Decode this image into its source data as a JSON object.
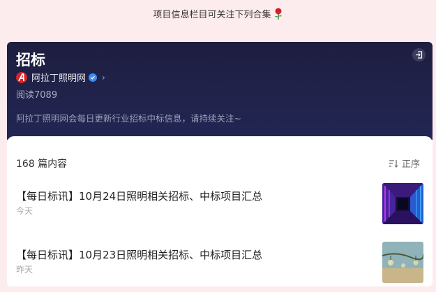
{
  "top_tip": {
    "text": "项目信息栏目可关注下列合集",
    "emoji_icon": "rose-icon"
  },
  "header": {
    "title": "招标",
    "author": "阿拉丁照明网",
    "reads": "阅读7089",
    "description": "阿拉丁照明网会每日更新行业招标中标信息，请持续关注~"
  },
  "list": {
    "count": "168 篇内容",
    "sort_label": "正序",
    "items": [
      {
        "title": "【每日标讯】10月24日照明相关招标、中标项目汇总",
        "date": "今天"
      },
      {
        "title": "【每日标讯】10月23日照明相关招标、中标项目汇总",
        "date": "昨天"
      }
    ]
  },
  "colors": {
    "header_bg": "#1d1e3f",
    "page_bg": "#fdeced",
    "verified": "#3c8cf4",
    "logo": "#d8232a"
  }
}
